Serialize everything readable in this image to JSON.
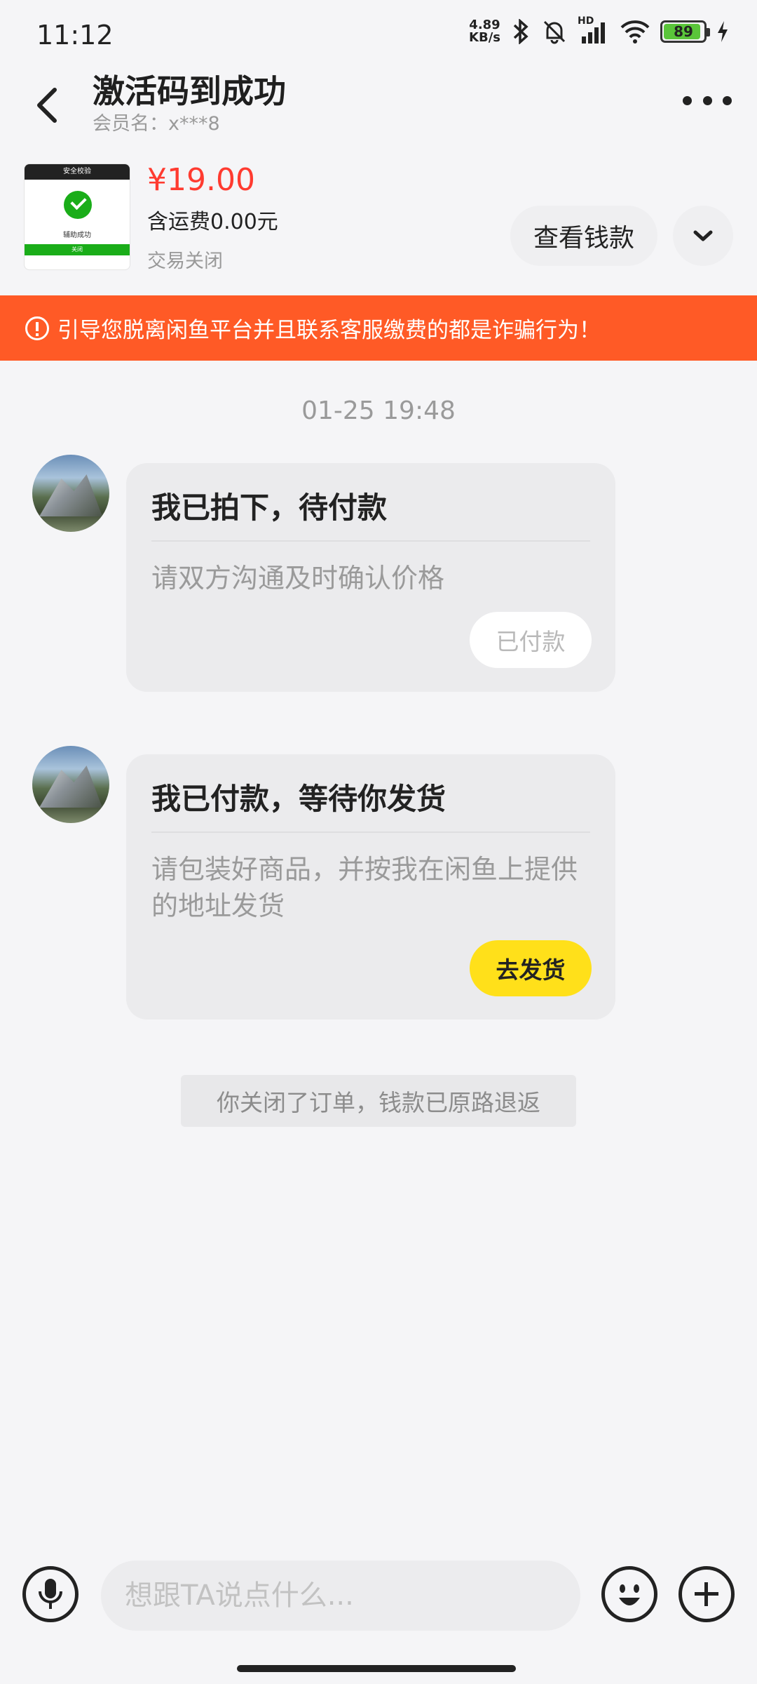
{
  "status_bar": {
    "time": "11:12",
    "net_speed_value": "4.89",
    "net_speed_unit": "KB/s",
    "battery_level": "89",
    "network": "HD"
  },
  "header": {
    "title": "激活码到成功",
    "member": "会员名：x***8"
  },
  "product": {
    "thumb_bar": "安全校验",
    "thumb_text": "辅助成功",
    "thumb_button": "关闭",
    "price": "¥19.00",
    "shipping": "含运费0.00元",
    "status": "交易关闭",
    "view_money_label": "查看钱款"
  },
  "warning": {
    "text": "引导您脱离闲鱼平台并且联系客服缴费的都是诈骗行为！",
    "color": "#ff5a26"
  },
  "chat": {
    "timestamp": "01-25 19:48",
    "messages": [
      {
        "title": "我已拍下，待付款",
        "desc": "请双方沟通及时确认价格",
        "button": "已付款"
      },
      {
        "title": "我已付款，等待你发货",
        "desc": "请包装好商品，并按我在闲鱼上提供的地址发货",
        "button": "去发货"
      }
    ],
    "system_note": "你关闭了订单，钱款已原路退返"
  },
  "input_bar": {
    "placeholder": "想跟TA说点什么..."
  },
  "colors": {
    "accent_yellow": "#ffe01a",
    "price_red": "#ff3b30"
  }
}
